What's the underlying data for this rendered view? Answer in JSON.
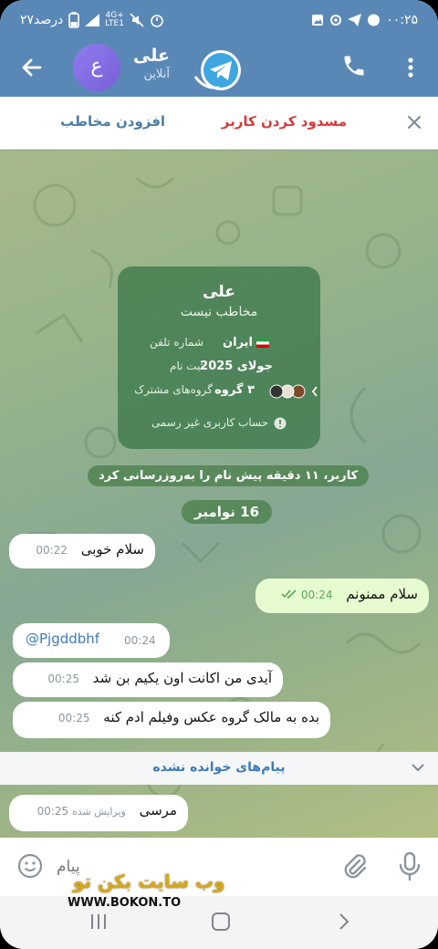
{
  "status_bar": {
    "time": "۰۰:۲۵",
    "battery": "۲۷درصد",
    "net_top": "4G+",
    "net_bottom": "LTE1"
  },
  "header": {
    "back_icon": "arrow-left-icon",
    "avatar_letter": "ع",
    "avatar_color": "#8e7cf0",
    "contact_name": "علی",
    "contact_status": "آنلاین",
    "brand_color": "#5a88b6"
  },
  "action_bar": {
    "block_label": "مسدود کردن کاربر",
    "add_contact_label": "افزودن مخاطب"
  },
  "info_card": {
    "name": "علی",
    "subtitle": "مخاطب نیست",
    "phone_label": "شماره تلفن",
    "phone_value": "ایران",
    "registered_label": "ثبت نام",
    "registered_value": "جولای 2025",
    "groups_label": "گروه‌های مشترک",
    "groups_value": "۳ گروه",
    "footer": "حساب کاربری غیر رسمی"
  },
  "service_messages": {
    "name_update": "کاربر، ۱۱ دقیقه پیش نام را به‌روزرسانی کرد",
    "date": "16 نوامبر"
  },
  "messages": [
    {
      "text": "سلام خوبی",
      "time": "00:22",
      "direction": "in"
    },
    {
      "text": "سلام ممنونم",
      "time": "00:24",
      "direction": "out"
    },
    {
      "text": "@Pjgddbhf",
      "time": "00:24",
      "direction": "in"
    },
    {
      "text": "آیدی من اکانت اون یکیم بن شد",
      "time": "00:25",
      "direction": "in"
    },
    {
      "text": "بده به مالک گروه عکس وفیلم ادم کنه",
      "time": "00:25",
      "direction": "in"
    },
    {
      "text": "مرسی",
      "time": "00:25",
      "edited": "ویرایش شده",
      "direction": "in"
    }
  ],
  "unread_label": "پیام‌های خوانده نشده",
  "input": {
    "placeholder": "پیام"
  },
  "watermark": {
    "line1": "وب سایت بکن تو",
    "line2": "WWW.BOKON.TO"
  }
}
